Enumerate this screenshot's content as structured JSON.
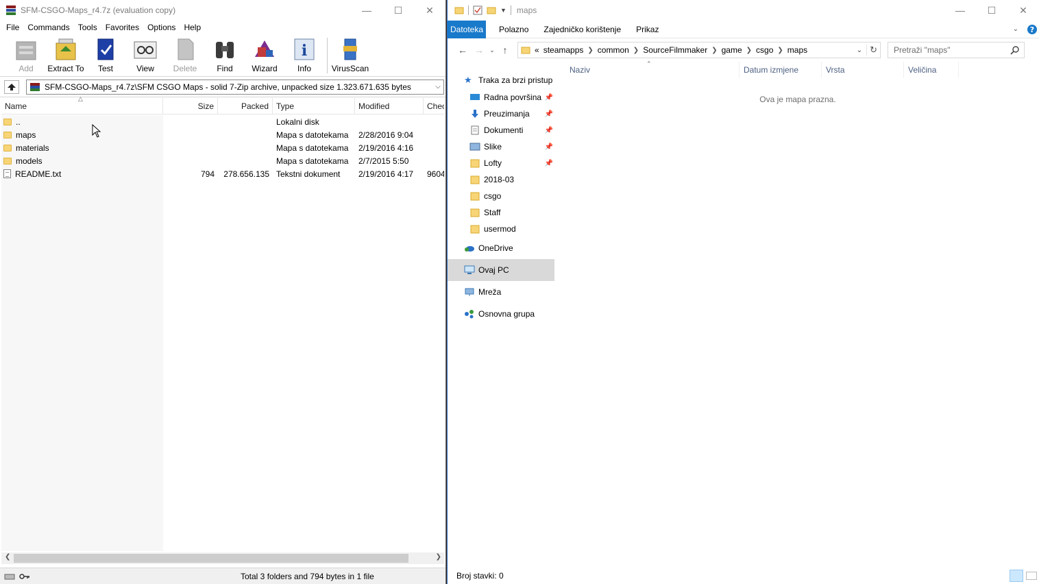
{
  "rar": {
    "title": "SFM-CSGO-Maps_r4.7z (evaluation copy)",
    "menu": [
      "File",
      "Commands",
      "Tools",
      "Favorites",
      "Options",
      "Help"
    ],
    "toolbar": {
      "add": "Add",
      "extract": "Extract To",
      "test": "Test",
      "view": "View",
      "delete": "Delete",
      "find": "Find",
      "wizard": "Wizard",
      "info": "Info",
      "virusscan": "VirusScan"
    },
    "path": "SFM-CSGO-Maps_r4.7z\\SFM CSGO Maps - solid 7-Zip archive, unpacked size 1.323.671.635 bytes",
    "columns": {
      "name": "Name",
      "size": "Size",
      "packed": "Packed",
      "type": "Type",
      "modified": "Modified",
      "check": "Chec"
    },
    "rows": [
      {
        "name": "..",
        "size": "",
        "packed": "",
        "type": "Lokalni disk",
        "modified": "",
        "check": "",
        "icon": "folder-icon"
      },
      {
        "name": "maps",
        "size": "",
        "packed": "",
        "type": "Mapa s datotekama",
        "modified": "2/28/2016 9:04",
        "check": "",
        "icon": "folder-icon"
      },
      {
        "name": "materials",
        "size": "",
        "packed": "",
        "type": "Mapa s datotekama",
        "modified": "2/19/2016 4:16",
        "check": "",
        "icon": "folder-icon"
      },
      {
        "name": "models",
        "size": "",
        "packed": "",
        "type": "Mapa s datotekama",
        "modified": "2/7/2015 5:50",
        "check": "",
        "icon": "folder-icon"
      },
      {
        "name": "README.txt",
        "size": "794",
        "packed": "278.656.135",
        "type": "Tekstni dokument",
        "modified": "2/19/2016 4:17",
        "check": "9604",
        "icon": "text-file-icon"
      }
    ],
    "status": "Total 3 folders and 794 bytes in 1 file"
  },
  "explorer": {
    "title": "maps",
    "tabs": {
      "file": "Datoteka",
      "home": "Polazno",
      "share": "Zajedničko korištenje",
      "view": "Prikaz"
    },
    "breadcrumb": [
      "«",
      "steamapps",
      "common",
      "SourceFilmmaker",
      "game",
      "csgo",
      "maps"
    ],
    "search_placeholder": "Pretraži \"maps\"",
    "nav": {
      "quick_access": "Traka za brzi pristup",
      "desktop": "Radna površina",
      "downloads": "Preuzimanja",
      "documents": "Dokumenti",
      "pictures": "Slike",
      "lofty": "Lofty",
      "f2018": "2018-03",
      "csgo": "csgo",
      "staff": "Staff",
      "usermod": "usermod",
      "onedrive": "OneDrive",
      "thispc": "Ovaj PC",
      "network": "Mreža",
      "homegroup": "Osnovna grupa"
    },
    "columns": {
      "name": "Naziv",
      "date": "Datum izmjene",
      "type": "Vrsta",
      "size": "Veličina"
    },
    "empty": "Ova je mapa prazna.",
    "status": "Broj stavki: 0"
  }
}
